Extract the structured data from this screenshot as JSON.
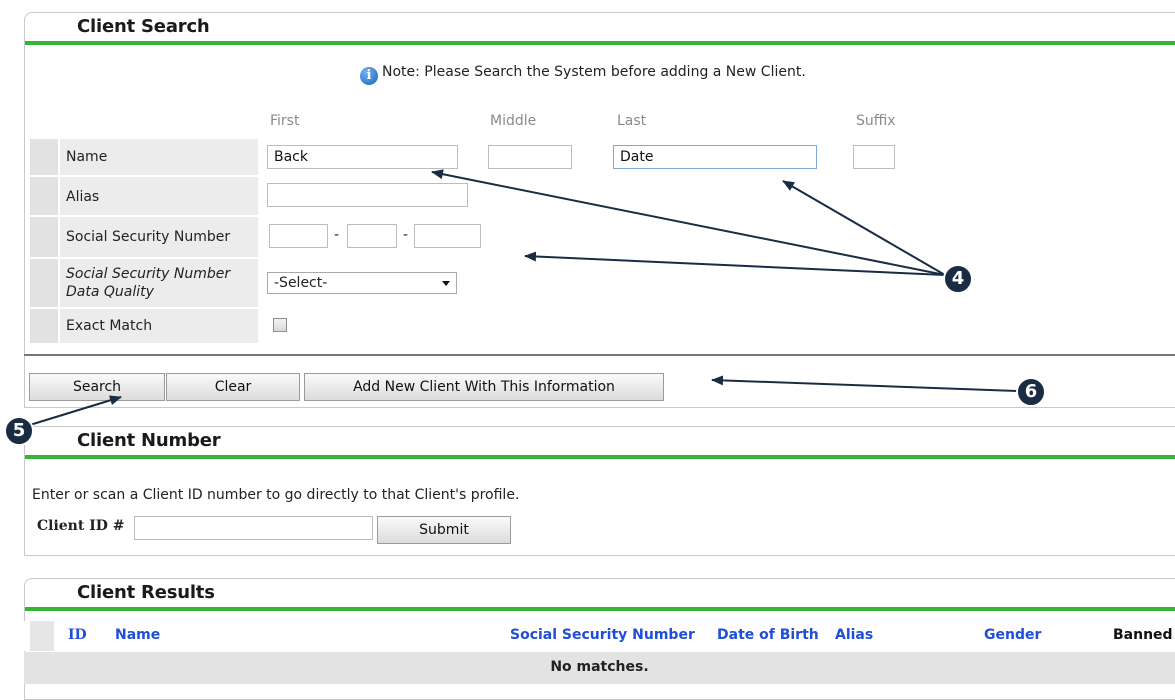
{
  "client_search": {
    "title": "Client Search",
    "note": "Note: Please Search the System before adding a New Client.",
    "col_headers": {
      "first": "First",
      "middle": "Middle",
      "last": "Last",
      "suffix": "Suffix"
    },
    "labels": {
      "name": "Name",
      "alias": "Alias",
      "ssn": "Social Security Number",
      "ssn_quality_1": "Social Security Number",
      "ssn_quality_2": "Data Quality",
      "exact_match": "Exact Match"
    },
    "values": {
      "first": "Back",
      "middle": "",
      "last": "Date",
      "suffix": "",
      "alias": "",
      "ssn1": "",
      "ssn2": "",
      "ssn3": ""
    },
    "ssn_sep": "-",
    "ssn_quality_select": "-Select-",
    "buttons": {
      "search": "Search",
      "clear": "Clear",
      "add_new": "Add New Client With This Information"
    }
  },
  "client_number": {
    "title": "Client Number",
    "instruction": "Enter or scan a Client ID number to go directly to that Client's profile.",
    "id_label": "Client ID #",
    "id_value": "",
    "submit": "Submit"
  },
  "client_results": {
    "title": "Client Results",
    "columns": [
      "ID",
      "Name",
      "Social Security Number",
      "Date of Birth",
      "Alias",
      "Gender",
      "Banned"
    ],
    "empty_message": "No matches."
  },
  "callouts": {
    "c4": "4",
    "c5": "5",
    "c6": "6"
  },
  "colors": {
    "accent_green": "#35b535",
    "link_blue": "#1f4fd8",
    "callout_bg": "#1a2b44",
    "arrow": "#1a2b44"
  }
}
